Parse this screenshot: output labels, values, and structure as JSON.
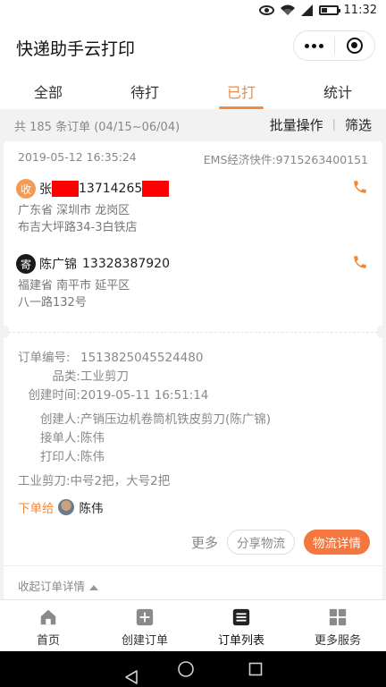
{
  "status_bar": {
    "time": "11:32"
  },
  "app": {
    "title": "快递助手云打印"
  },
  "tabs": [
    {
      "label": "全部",
      "active": false
    },
    {
      "label": "待打",
      "active": false
    },
    {
      "label": "已打",
      "active": true
    },
    {
      "label": "统计",
      "active": false
    }
  ],
  "summary": {
    "text": "共 185 条订单 (04/15~06/04)",
    "batch_label": "批量操作",
    "filter_label": "筛选",
    "separator": "|"
  },
  "order": {
    "time": "2019-05-12 16:35:24",
    "tracking": "EMS经济快件:9715263400151",
    "receiver": {
      "badge": "收",
      "name": "张",
      "phone": "13714265",
      "province_city": "广东省 深圳市 龙岗区",
      "street": "布吉大坪路34-3白铁店"
    },
    "sender": {
      "badge": "寄",
      "name": "陈广锦",
      "phone": "13328387920",
      "province_city": "福建省 南平市 延平区",
      "street": "八一路132号"
    },
    "details": [
      {
        "label": "订单编号:",
        "value": "1513825045524480"
      },
      {
        "label": "品类:",
        "value": "工业剪刀"
      },
      {
        "label": "创建时间:",
        "value": "2019-05-11 16:51:14"
      },
      {
        "label": "创建人:",
        "value": "产销压边机卷筒机铁皮剪刀(陈广锦)"
      },
      {
        "label": "接单人:",
        "value": "陈伟"
      },
      {
        "label": "打印人:",
        "value": "陈伟"
      }
    ],
    "note": "工业剪刀:中号2把，大号2把",
    "assign_label": "下单给",
    "assign_name": "陈伟",
    "more_label": "更多",
    "share_label": "分享物流",
    "detail_label": "物流详情",
    "collapse_label": "收起订单详情"
  },
  "tabbar": [
    {
      "label": "首页",
      "icon": "home-icon"
    },
    {
      "label": "创建订单",
      "icon": "plus-square-icon"
    },
    {
      "label": "订单列表",
      "icon": "list-icon",
      "active": true
    },
    {
      "label": "更多服务",
      "icon": "grid-icon"
    }
  ],
  "colors": {
    "accent": "#f28a3c",
    "primary_button": "#f4773f",
    "redaction": "#ff0000"
  }
}
